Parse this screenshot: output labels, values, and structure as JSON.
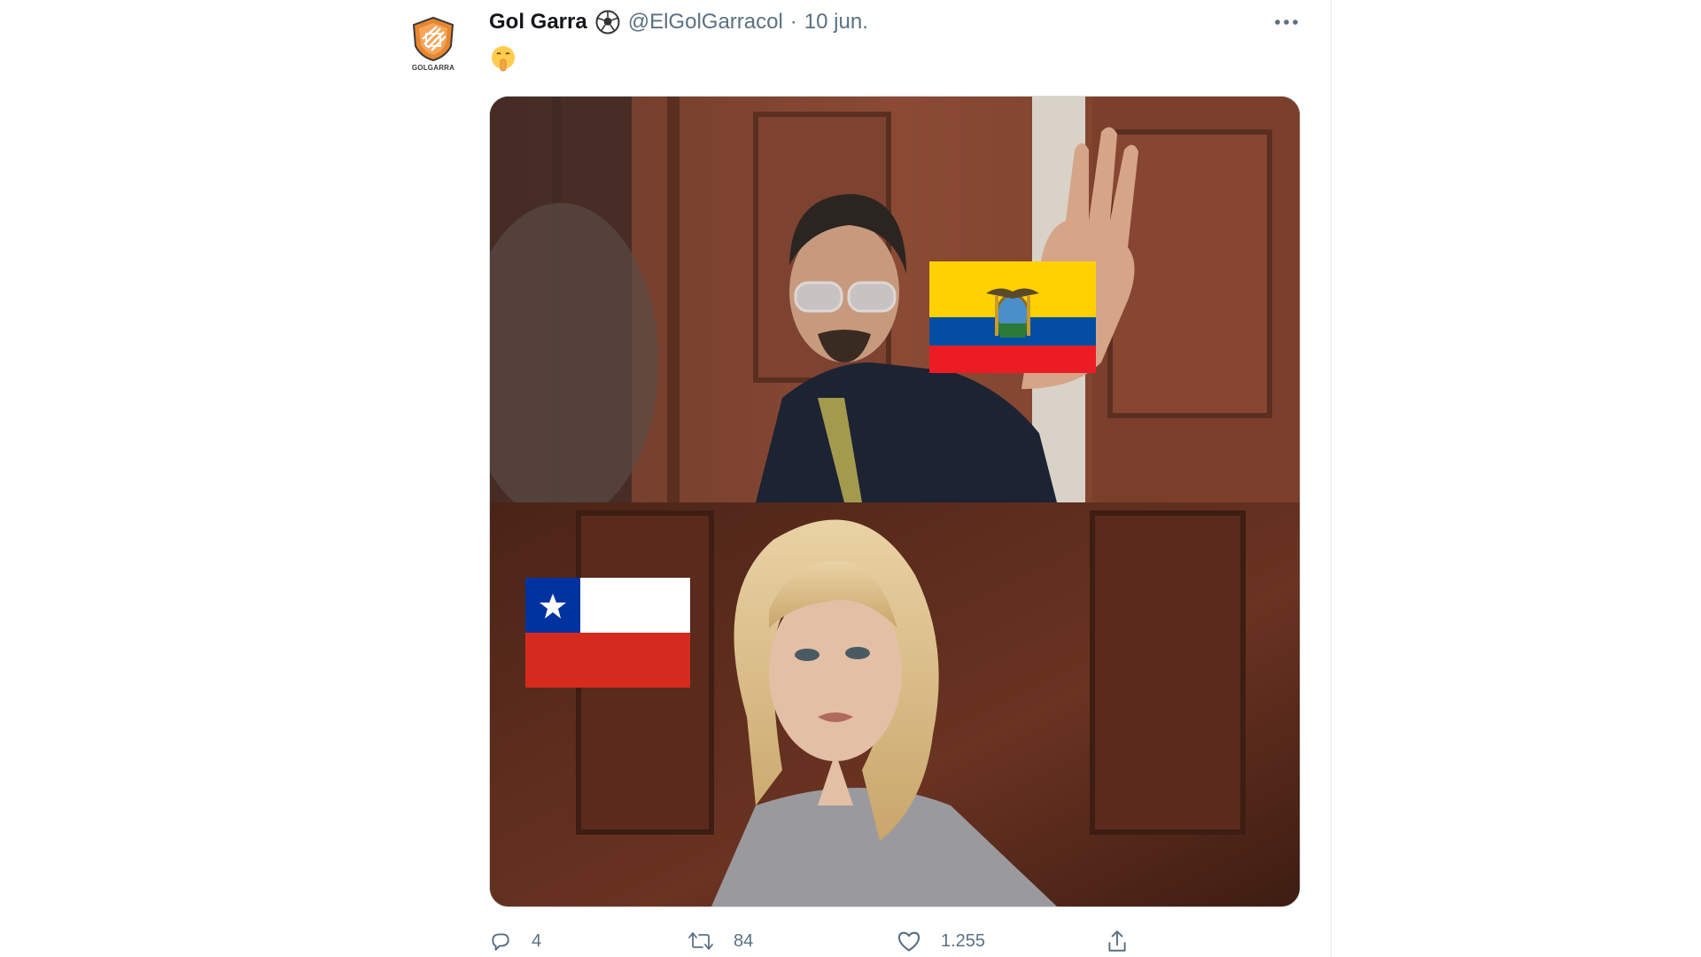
{
  "tweet": {
    "author_name": "Gol Garra",
    "author_handle": "@ElGolGarracol",
    "separator": "·",
    "date": "10 jun.",
    "text": "🤫",
    "avatar_caption": "GOLGARRA",
    "name_badge_icon": "soccer-ball-icon"
  },
  "media": {
    "top_flag": "Ecuador flag",
    "bottom_flag": "Chile flag",
    "colors": {
      "ecuador_yellow": "#ffd100",
      "ecuador_blue": "#034ea2",
      "ecuador_red": "#ed1c24",
      "chile_blue": "#0033a0",
      "chile_white": "#ffffff",
      "chile_red": "#d52b1e"
    }
  },
  "actions": {
    "reply": {
      "icon": "reply-icon",
      "count": "4"
    },
    "retweet": {
      "icon": "retweet-icon",
      "count": "84"
    },
    "like": {
      "icon": "heart-icon",
      "count": "1.255"
    },
    "share": {
      "icon": "share-icon"
    }
  },
  "colors": {
    "text_primary": "#14171a",
    "text_secondary": "#5b7083",
    "avatar_orange": "#e8862e"
  }
}
